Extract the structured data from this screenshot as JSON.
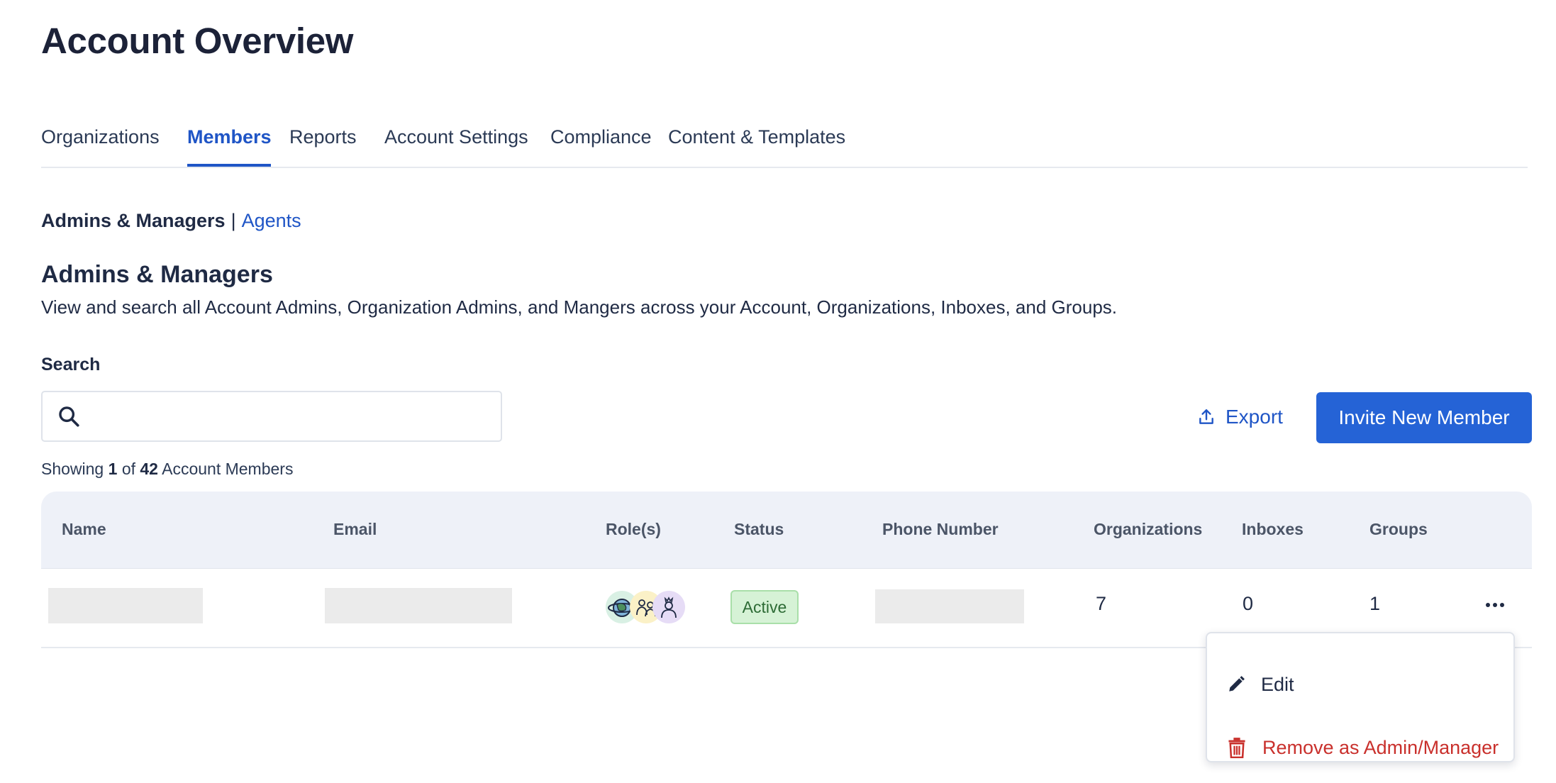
{
  "page": {
    "title": "Account Overview"
  },
  "tabs": [
    {
      "label": "Organizations",
      "active": false
    },
    {
      "label": "Members",
      "active": true
    },
    {
      "label": "Reports",
      "active": false
    },
    {
      "label": "Account Settings",
      "active": false
    },
    {
      "label": "Compliance",
      "active": false
    },
    {
      "label": "Content & Templates",
      "active": false
    }
  ],
  "subnav": {
    "current": "Admins & Managers",
    "separator": "|",
    "link": "Agents"
  },
  "section": {
    "title": "Admins & Managers",
    "description": "View and search all Account Admins, Organization Admins, and Mangers across your Account, Organizations, Inboxes, and Groups."
  },
  "search": {
    "label": "Search",
    "value": "",
    "placeholder": "",
    "icon": "search-icon"
  },
  "actions": {
    "export_label": "Export",
    "export_icon": "upload-icon",
    "invite_label": "Invite New Member"
  },
  "results": {
    "prefix": "Showing",
    "shown": "1",
    "of": "of",
    "total": "42",
    "suffix": "Account Members"
  },
  "table": {
    "columns": [
      "Name",
      "Email",
      "Role(s)",
      "Status",
      "Phone Number",
      "Organizations",
      "Inboxes",
      "Groups"
    ],
    "rows": [
      {
        "name": "",
        "email": "",
        "roles": [
          "account-admin-avatar",
          "organization-admin-avatar",
          "manager-avatar"
        ],
        "status": "Active",
        "phone": "",
        "organizations": "7",
        "inboxes": "0",
        "groups": "1"
      }
    ]
  },
  "row_menu": {
    "items": [
      {
        "label": "Edit",
        "icon": "pencil-icon"
      },
      {
        "label": "Remove as Admin/Manager",
        "icon": "trash-icon"
      }
    ]
  },
  "colors": {
    "accent": "#1f55c6",
    "primary_button": "#2563d6",
    "danger": "#c9302c",
    "status_active_bg": "#d6f2d6",
    "header_bg": "#eef1f8"
  }
}
